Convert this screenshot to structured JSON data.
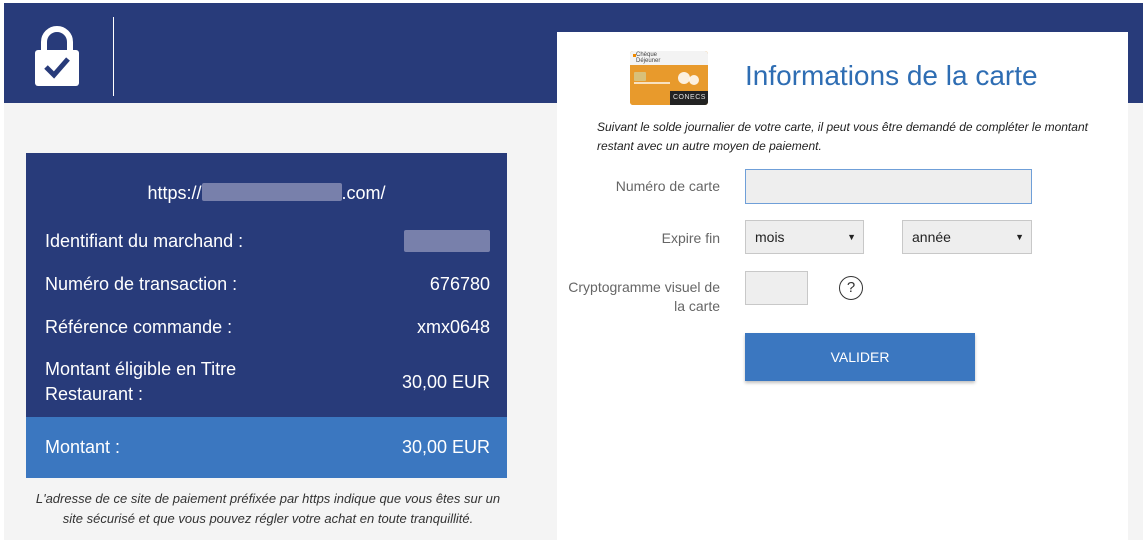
{
  "header": {
    "lock_icon": "lock-check-icon"
  },
  "summary": {
    "url_prefix": "https://",
    "url_suffix": ".com/",
    "rows": [
      {
        "label": "Identifiant du marchand :",
        "value": ""
      },
      {
        "label": "Numéro de transaction :",
        "value": "676780"
      },
      {
        "label": "Référence commande :",
        "value": "xmx0648"
      },
      {
        "label": "Montant éligible en Titre Restaurant :",
        "value": "30,00 EUR"
      }
    ],
    "total": {
      "label": "Montant :",
      "value": "30,00 EUR"
    },
    "secure_note": "L'adresse de ce site de paiement préfixée par https indique que vous êtes sur un site sécurisé et que vous pouvez régler votre achat en toute tranquillité."
  },
  "payment": {
    "title": "Informations de la carte",
    "note": "Suivant le solde journalier de votre carte, il peut vous être demandé de compléter le montant restant avec un autre moyen de paiement.",
    "card_number_label": "Numéro de carte",
    "card_number_value": "",
    "expiry_label": "Expire fin",
    "month_selected": "mois",
    "year_selected": "année",
    "cvv_label": "Cryptogramme visuel de la carte",
    "cvv_value": "",
    "help_glyph": "?",
    "submit_label": "VALIDER",
    "card_logo": {
      "brand": "Chèque Déjeuner",
      "lines": [
        "Chèque",
        "Déjeuner"
      ],
      "network": "CONECS"
    }
  },
  "colors": {
    "header": "#283b7a",
    "summary": "#283b7a",
    "accent": "#3b77c0",
    "title": "#2e6db3"
  }
}
